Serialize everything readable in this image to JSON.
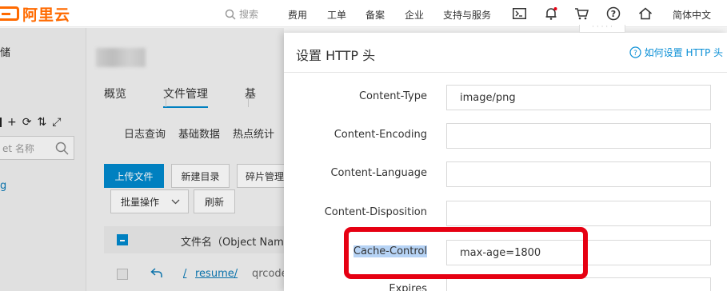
{
  "topbar": {
    "logo_text": "阿里云",
    "search_placeholder": "搜索",
    "nav": [
      "费用",
      "工单",
      "备案",
      "企业",
      "支持与服务"
    ],
    "icons": [
      "terminal-icon",
      "bell-icon",
      "cart-icon",
      "help-icon",
      "home-icon"
    ],
    "language": "简体中文",
    "accent_color": "#ff6a00"
  },
  "left_panel": {
    "title": "储",
    "tool_glyphs": [
      "+",
      "⟳",
      "⇅",
      "⤢"
    ],
    "search_placeholder": "et 名称",
    "selected_item": "g"
  },
  "main": {
    "tabs": [
      "概览",
      "文件管理",
      "基"
    ],
    "subtabs": [
      "日志查询",
      "基础数据",
      "热点统计"
    ],
    "buttons": {
      "upload": "上传文件",
      "new_dir": "新建目录",
      "fragments": "碎片管理",
      "batch": "批量操作",
      "refresh": "刷新"
    },
    "table_header_name": "文件名（Object Name",
    "row_path": "/",
    "row_folder": "resume/",
    "row_subfolder": "qrcodes/"
  },
  "drawer": {
    "title": "设置 HTTP 头",
    "help_link": "如何设置 HTTP 头",
    "fields": [
      {
        "label": "Content-Type",
        "value": "image/png"
      },
      {
        "label": "Content-Encoding",
        "value": ""
      },
      {
        "label": "Content-Language",
        "value": ""
      },
      {
        "label": "Content-Disposition",
        "value": ""
      },
      {
        "label": "Cache-Control",
        "value": "max-age=1800"
      },
      {
        "label": "Expires",
        "value": ""
      }
    ],
    "link_color": "#0a8fd6",
    "annotation_color": "#e60012"
  }
}
